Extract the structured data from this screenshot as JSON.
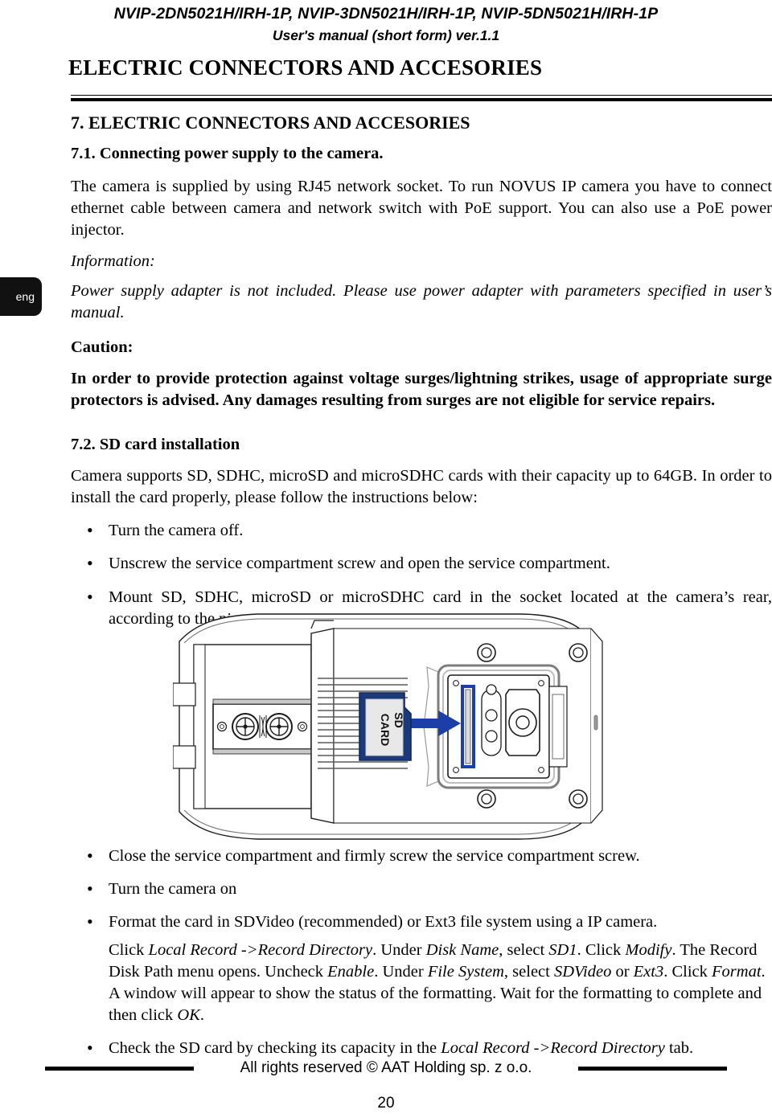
{
  "header": {
    "models_line": "NVIP-2DN5021H/IRH-1P, NVIP-3DN5021H/IRH-1P, NVIP-5DN5021H/IRH-1P",
    "manual_line": "User's manual (short form) ver.1.1"
  },
  "chapter": {
    "title": "ELECTRIC CONNECTORS AND ACCESORIES"
  },
  "language_tab": {
    "label": "eng"
  },
  "section_7": {
    "heading": "7. ELECTRIC CONNECTORS AND ACCESORIES",
    "sub_71": {
      "heading": "7.1. Connecting  power supply to the camera.",
      "paragraph": "The camera is supplied by using RJ45 network socket. To run NOVUS IP camera you have to connect ethernet cable between camera and network switch with PoE support. You can also use a PoE power injector.",
      "information_label": "Information:",
      "information_text": "Power supply adapter is not included. Please use power adapter with parameters specified in user’s manual.",
      "caution_label": "Caution:",
      "caution_text": "In order to provide protection against voltage surges/lightning strikes, usage of appropriate surge protectors is advised. Any damages resulting from surges are not eligible for service repairs."
    },
    "sub_72": {
      "heading": "7.2. SD card installation",
      "intro": "Camera supports SD, SDHC, microSD and microSDHC cards with their capacity up to 64GB. In order to install the card properly, please follow the instructions below:",
      "steps_before": [
        "Turn the camera off.",
        "Unscrew the service compartment screw and open the service compartment.",
        "Mount SD, SDHC, microSD or microSDHC card in the socket located at the camera’s rear, according to the picture:"
      ],
      "steps_after": [
        "Close the service compartment and firmly screw the service compartment screw.",
        "Turn the camera on",
        "Format the card in SDVideo (recommended) or Ext3 file system using a IP camera."
      ],
      "format_detail": {
        "s1": "Click ",
        "i1": "Local Record ->Record Directory",
        "s2": ". Under ",
        "i2": "Disk Name",
        "s3": ", select ",
        "i3": "SD1",
        "s4": ". Click ",
        "i4": "Modify",
        "s5": ". The Record Disk Path menu opens. Uncheck ",
        "i5": "Enable",
        "s6": ". Under ",
        "i6": "File System",
        "s7": ", select ",
        "i7": "SDVideo",
        "s8": " or ",
        "i8": "Ext3",
        "s9": ". Click ",
        "i9": "Format",
        "s10": ". A window will appear to show the status of the formatting. Wait for the formatting to complete and then click ",
        "i10": "OK",
        "s11": "."
      },
      "last_step": {
        "s1": "Check the SD card by checking its capacity in the ",
        "i1": "Local Record ->Record Directory",
        "s2": " tab."
      }
    }
  },
  "diagram": {
    "sd_card_label_line1": "SD",
    "sd_card_label_line2": "CARD",
    "colors": {
      "card_border": "#1b3a7a",
      "card_face": "#e8e8e8",
      "arrow": "#1b3ea8",
      "slot_highlight": "#1b3ea8",
      "outline": "#1a1a1a",
      "shade": "#9a9a9a"
    }
  },
  "footer": {
    "copyright": "All rights reserved © AAT Holding sp. z o.o.",
    "page_number": "20"
  }
}
